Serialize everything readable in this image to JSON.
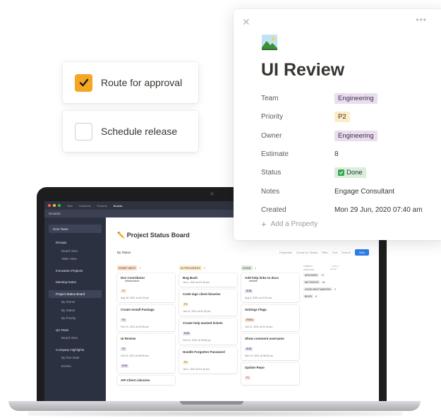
{
  "checklist": [
    {
      "label": "Route for approval",
      "checked": true
    },
    {
      "label": "Schedule release",
      "checked": false
    }
  ],
  "panel": {
    "title": "UI Review",
    "properties": [
      {
        "key": "Team",
        "value": "Engineering",
        "style": "tag-eng"
      },
      {
        "key": "Priority",
        "value": "P2",
        "style": "tag-p2"
      },
      {
        "key": "Owner",
        "value": "Engineering",
        "style": "tag-eng"
      },
      {
        "key": "Estimate",
        "value": "8",
        "style": "text"
      },
      {
        "key": "Status",
        "value": "Done",
        "style": "tag-done"
      },
      {
        "key": "Notes",
        "value": "Engage Consultant",
        "style": "text"
      },
      {
        "key": "Created",
        "value": "Mon 29 Jun, 2020 07:40 am",
        "style": "text"
      }
    ],
    "add_property": "Add a Property"
  },
  "screen": {
    "tabs": [
      "Swit",
      "Channels",
      "Pockets",
      "Boards"
    ],
    "nav": [
      "Novanto"
    ],
    "team": "Octo Team",
    "sidebar": [
      {
        "label": "Devops",
        "kind": "sec"
      },
      {
        "label": "Board View",
        "kind": "sub"
      },
      {
        "label": "Table View",
        "kind": "sub"
      },
      {
        "label": "",
        "kind": "gap"
      },
      {
        "label": "Innovation Projects",
        "kind": "sec"
      },
      {
        "label": "",
        "kind": "gap"
      },
      {
        "label": "Meeting Notes",
        "kind": "sec"
      },
      {
        "label": "",
        "kind": "gap"
      },
      {
        "label": "Project Status Board",
        "kind": "act"
      },
      {
        "label": "By Owner",
        "kind": "sub"
      },
      {
        "label": "By Status",
        "kind": "sub"
      },
      {
        "label": "By Priority",
        "kind": "sub"
      },
      {
        "label": "",
        "kind": "gap"
      },
      {
        "label": "QA Team",
        "kind": "sec"
      },
      {
        "label": "Board View",
        "kind": "sub"
      },
      {
        "label": "",
        "kind": "gap"
      },
      {
        "label": "Company Highlights",
        "kind": "sec"
      },
      {
        "label": "By Due Date",
        "kind": "sub"
      },
      {
        "label": "Events",
        "kind": "sub"
      }
    ],
    "board_title": "Project Status Board",
    "view": "By Status",
    "toolbar": {
      "properties": "Properties",
      "group_by": "Group by: Status",
      "filter": "Filter",
      "sort": "Sort",
      "search": "Search",
      "new": "New"
    },
    "columns": [
      {
        "name": "START NEXT",
        "count": "4",
        "color": "#fadec9",
        "cards": [
          {
            "title": "Dev Contributor",
            "sub": "Infrastructure",
            "tag": "P2",
            "tagClass": "p-yellow",
            "meta": "Aug 18, 2021 at 04:12 pm"
          },
          {
            "title": "Create Install Package",
            "sub": "",
            "tag": "P3",
            "tagClass": "p-purple",
            "meta": "Feb 21, 2021 at 03:05 pm"
          },
          {
            "title": "UI Review",
            "sub": "",
            "tag": "P2",
            "tagClass": "p-purple",
            "meta": "Oct 13, 2021 at 08:05 am",
            "tag2": "BOB"
          },
          {
            "title": "API Client Libraries",
            "sub": "",
            "tag": "",
            "tagClass": "",
            "meta": ""
          }
        ]
      },
      {
        "name": "IN PROGRESS",
        "count": "5",
        "color": "#fdecc8",
        "cards": [
          {
            "title": "Bug Bash",
            "sub": "",
            "tag": "",
            "tagClass": "",
            "meta": "Jan 1, 2021 at 01:49 pm"
          },
          {
            "title": "Code-sign client binaries",
            "sub": "",
            "tag": "P3",
            "tagClass": "p-yellow",
            "meta": "Jan 11, 2021 at 01:49 pm"
          },
          {
            "title": "Create help wanted tickets",
            "sub": "",
            "tag": "BOB",
            "tagClass": "p-purple",
            "meta": "Feb 21, 2021 at 03:05 pm"
          },
          {
            "title": "Handle Forgotten Password",
            "sub": "",
            "tag": "P2",
            "tagClass": "p-yellow",
            "meta": "Jan 1, 2021 at 01:49 pm"
          }
        ]
      },
      {
        "name": "DONE",
        "count": "4",
        "color": "#dbeddb",
        "cards": [
          {
            "title": "Add help links to docs",
            "sub": "website",
            "tag": "BOB",
            "tagClass": "p-purple",
            "meta": "Aug 3, 2021 at 12:10 am"
          },
          {
            "title": "Settings Flags",
            "sub": "",
            "tag": "FRED",
            "tagClass": "p-orange",
            "meta": "Jan 11, 2021 at 01:49 pm"
          },
          {
            "title": "Show comment username",
            "sub": "",
            "tag": "BOB",
            "tagClass": "p-purple",
            "meta": "Mar 13, 2021 at 08:05 am"
          },
          {
            "title": "Update Repo",
            "sub": "",
            "tag": "P1",
            "tagClass": "p-red",
            "meta": ""
          }
        ]
      }
    ],
    "hidden": {
      "title": "Hidden columns",
      "add_group": "+ Add a group",
      "rows": [
        {
          "name": "ARCHIVED",
          "count": "74"
        },
        {
          "name": "NO STATUS",
          "count": "16"
        },
        {
          "name": "GOOD HELP WANTED",
          "count": "2"
        },
        {
          "name": "BUGS",
          "count": "6"
        }
      ]
    }
  }
}
